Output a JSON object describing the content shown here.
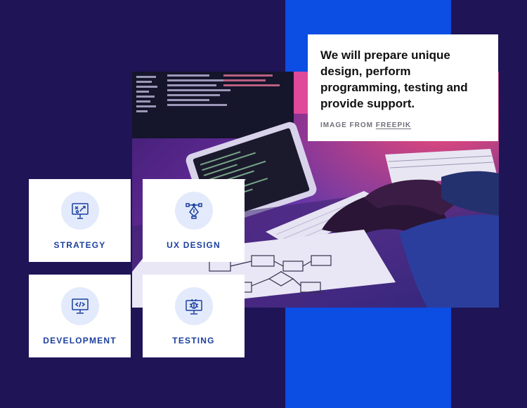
{
  "quote": {
    "text": "We will prepare unique design, perform programming, testing and provide support.",
    "credit_prefix": "IMAGE FROM ",
    "credit_link": "FREEPIK"
  },
  "services": [
    {
      "label": "STRATEGY",
      "icon": "strategy-board-icon"
    },
    {
      "label": "UX DESIGN",
      "icon": "pen-tool-icon"
    },
    {
      "label": "DEVELOPMENT",
      "icon": "code-monitor-icon"
    },
    {
      "label": "TESTING",
      "icon": "bug-monitor-icon"
    }
  ],
  "colors": {
    "background": "#1e1456",
    "band": "#0c4de3",
    "accent": "#1b3f9e",
    "icon_bg": "#e3eafb"
  }
}
